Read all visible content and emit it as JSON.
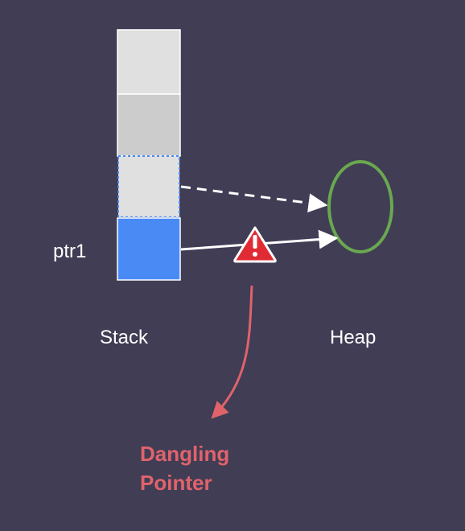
{
  "labels": {
    "pointer": "ptr1",
    "stack": "Stack",
    "heap": "Heap"
  },
  "callout": {
    "line1": "Dangling",
    "line2": "Pointer"
  },
  "colors": {
    "background": "#403d55",
    "stack_slot_top": "#e0e0e0",
    "stack_slot_mid": "#cccccc",
    "stack_slot_freed": "#e0e0e0",
    "stack_slot_ptr": "#4a8af4",
    "freed_border": "#4a8af4",
    "heap_object": "#6aa84f",
    "arrow": "#ffffff",
    "warning": "#e02b35",
    "callout": "#e0636b"
  },
  "icons": {
    "warning": "warning-triangle-icon"
  }
}
